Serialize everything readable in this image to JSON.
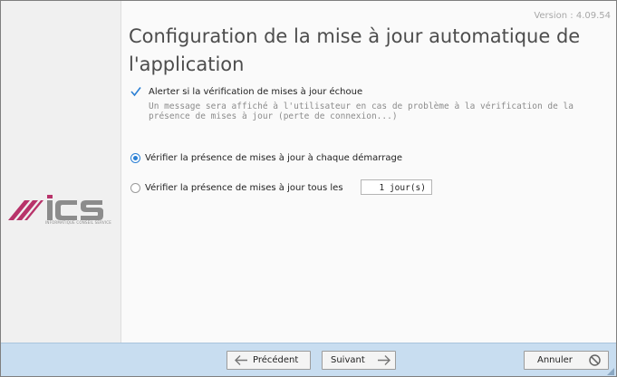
{
  "version": "Version : 4.09.54",
  "title": "Configuration de la mise à jour automatique de l'application",
  "logo_text": "ICS",
  "logo_caption": "INFORMATIQUE CONSEIL SERVICE",
  "alert_option": {
    "checked": true,
    "label": "Alerter si la vérification de mises à jour échoue",
    "description": "Un message sera affiché à l'utilisateur en cas de problème à la vérification de la présence de mises à jour (perte de connexion...)"
  },
  "radio_startup": {
    "selected": true,
    "label": "Vérifier la présence de mises à jour à chaque démarrage"
  },
  "radio_interval": {
    "selected": false,
    "label": "Vérifier la présence de mises à jour tous les",
    "value": "1 jour(s)"
  },
  "buttons": {
    "previous": "Précédent",
    "next": "Suivant",
    "cancel": "Annuler"
  },
  "colors": {
    "accent": "#2a7fd4",
    "bottom_bar": "#c8ddf0",
    "logo_pink": "#b8336a",
    "logo_gray": "#8c8c8c"
  },
  "icons": {
    "previous": "arrow-left-icon",
    "next": "arrow-right-icon",
    "cancel": "cancel-circle-icon"
  }
}
